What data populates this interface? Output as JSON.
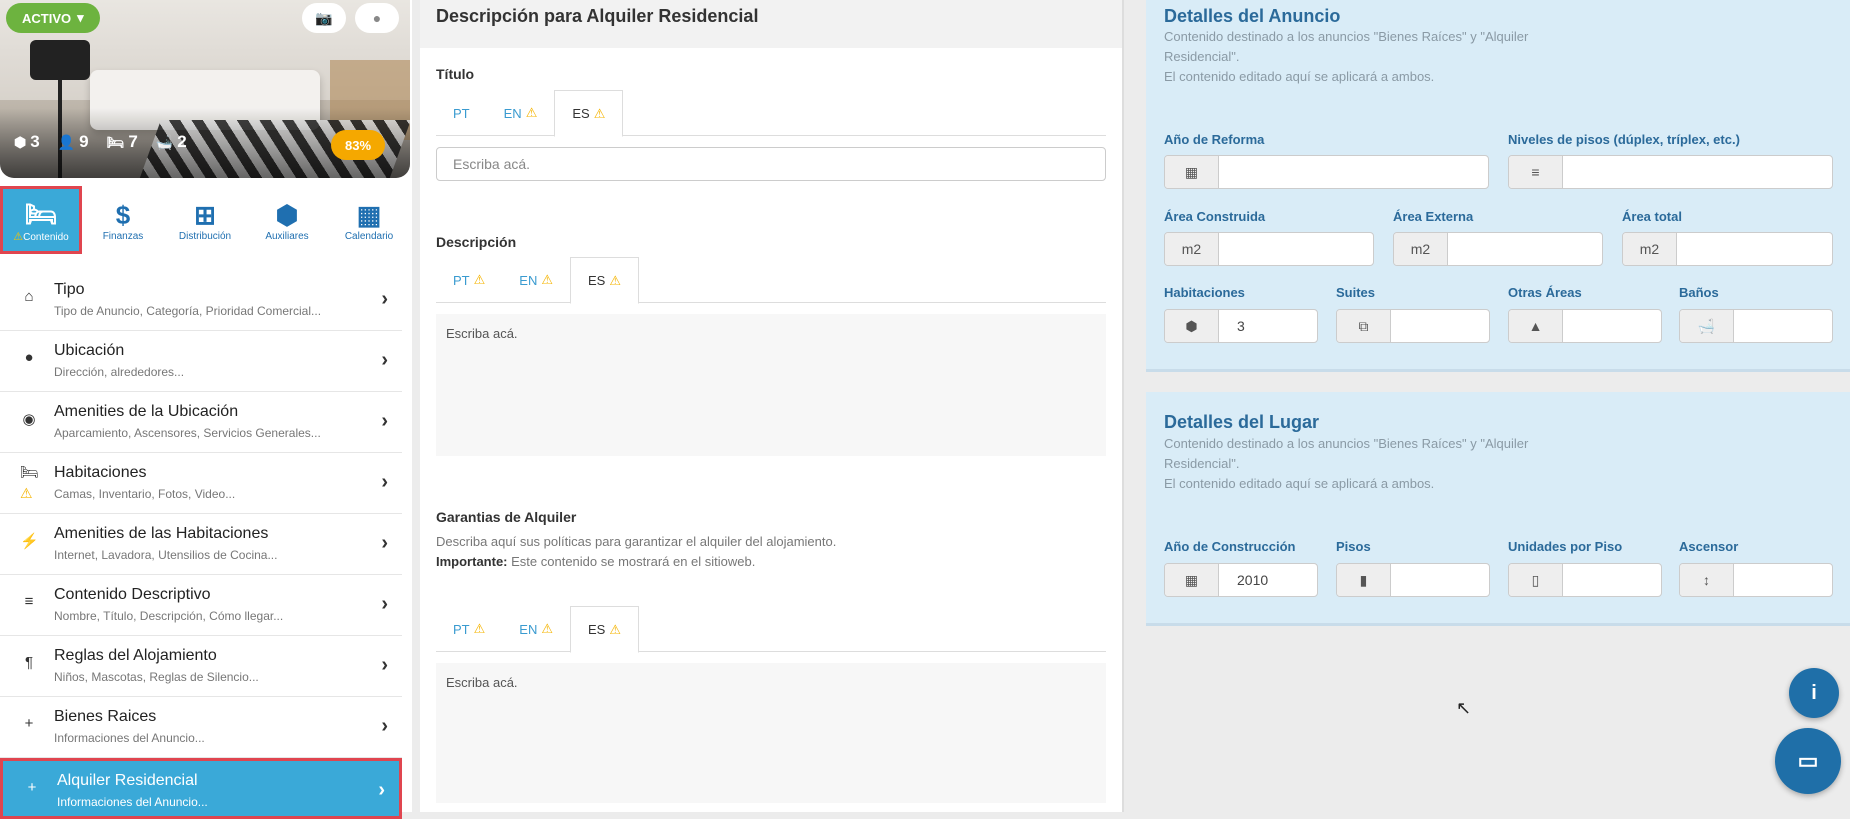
{
  "hero": {
    "status_label": "ACTIVO",
    "stats": [
      {
        "icon": "cube-icon",
        "value": "3"
      },
      {
        "icon": "user-icon",
        "value": "9"
      },
      {
        "icon": "bed-icon",
        "value": "7"
      },
      {
        "icon": "bath-icon",
        "value": "2"
      }
    ],
    "completion": "83%"
  },
  "nav_tabs": [
    {
      "label": "Contenido",
      "icon": "bed-icon",
      "active": true
    },
    {
      "label": "Finanzas",
      "icon": "dollar-icon"
    },
    {
      "label": "Distribución",
      "icon": "sitemap-icon"
    },
    {
      "label": "Auxiliares",
      "icon": "cubes-icon"
    },
    {
      "label": "Calendario",
      "icon": "calendar-icon"
    }
  ],
  "menu": [
    {
      "title": "Tipo",
      "subtitle": "Tipo de Anuncio, Categoría, Prioridad Comercial...",
      "icon": "home-icon"
    },
    {
      "title": "Ubicación",
      "subtitle": "Dirección, alrededores...",
      "icon": "map-pin-icon"
    },
    {
      "title": "Amenities de la Ubicación",
      "subtitle": "Aparcamiento, Ascensores, Servicios Generales...",
      "icon": "target-icon"
    },
    {
      "title": "Habitaciones",
      "subtitle": "Camas, Inventario, Fotos, Video...",
      "icon": "bed-icon"
    },
    {
      "title": "Amenities de las Habitaciones",
      "subtitle": "Internet, Lavadora, Utensilios de Cocina...",
      "icon": "plug-icon"
    },
    {
      "title": "Contenido Descriptivo",
      "subtitle": "Nombre, Título, Descripción, Cómo llegar...",
      "icon": "align-left-icon"
    },
    {
      "title": "Reglas del Alojamiento",
      "subtitle": "Niños, Mascotas, Reglas de Silencio...",
      "icon": "paragraph-icon"
    },
    {
      "title": "Bienes Raices",
      "subtitle": "Informaciones del Anuncio...",
      "icon": "plus-icon"
    },
    {
      "title": "Alquiler Residencial",
      "subtitle": "Informaciones del Anuncio...",
      "icon": "plus-icon"
    }
  ],
  "middle": {
    "heading": "Descripción para Alquiler Residencial",
    "titulo_label": "Título",
    "titulo_placeholder": "Escriba acá.",
    "descripcion_label": "Descripción",
    "descripcion_placeholder": "Escriba acá.",
    "garantias_label": "Garantias de Alquiler",
    "garantias_desc": "Describa aquí sus políticas para garantizar el alquiler del alojamiento.",
    "garantias_important_label": "Importante:",
    "garantias_important_text": "Este contenido se mostrará en el sitioweb.",
    "garantias_placeholder": "Escriba acá.",
    "tabs": [
      "PT",
      "EN",
      "ES"
    ]
  },
  "detalles_anuncio": {
    "title": "Detalles del Anuncio",
    "desc1": "Contenido destinado a los anuncios \"Bienes Raíces\" y \"Alquiler Residencial\".",
    "desc2": "El contenido editado aquí se aplicará a ambos.",
    "ano_reforma_label": "Año de Reforma",
    "niveles_label": "Niveles de pisos (dúplex, tríplex, etc.)",
    "area_construida_label": "Área Construida",
    "area_externa_label": "Área Externa",
    "area_total_label": "Área total",
    "unit": "m2",
    "habitaciones_label": "Habitaciones",
    "habitaciones_value": "3",
    "suites_label": "Suites",
    "otras_areas_label": "Otras Áreas",
    "banos_label": "Baños"
  },
  "detalles_lugar": {
    "title": "Detalles del Lugar",
    "desc1": "Contenido destinado a los anuncios \"Bienes Raíces\" y \"Alquiler Residencial\".",
    "desc2": "El contenido editado aquí se aplicará a ambos.",
    "ano_construccion_label": "Año de Construcción",
    "ano_construccion_value": "2010",
    "pisos_label": "Pisos",
    "unidades_label": "Unidades por Piso",
    "ascensor_label": "Ascensor"
  }
}
